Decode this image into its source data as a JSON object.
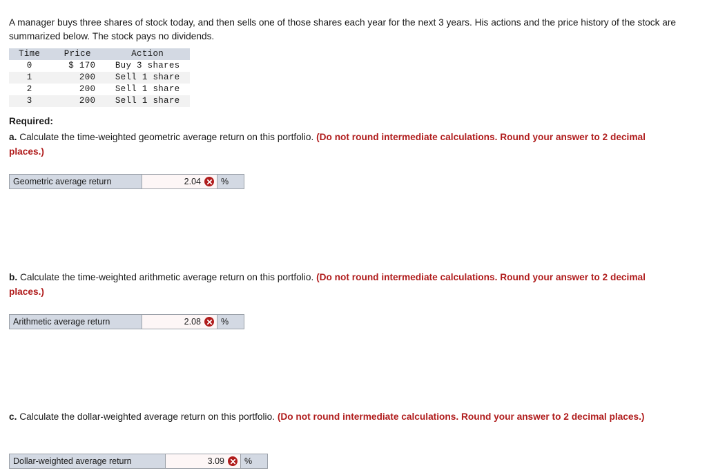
{
  "intro": {
    "paragraph": "A manager buys three shares of stock today, and then sells one of those shares each year for the next 3 years. His actions and the price history of the stock are summarized below. The stock pays no dividends."
  },
  "table": {
    "headers": [
      "Time",
      "Price",
      "Action"
    ],
    "rows": [
      {
        "time": "0",
        "price": "$ 170",
        "action": "Buy 3 shares"
      },
      {
        "time": "1",
        "price": "200",
        "action": "Sell 1 share"
      },
      {
        "time": "2",
        "price": "200",
        "action": "Sell 1 share"
      },
      {
        "time": "3",
        "price": "200",
        "action": "Sell 1 share"
      }
    ]
  },
  "required": {
    "heading": "Required:"
  },
  "questions": [
    {
      "label": "a.",
      "text": " Calculate the time-weighted geometric average return on this portfolio. ",
      "note": "(Do not round intermediate calculations. Round your answer to 2 decimal places.)"
    },
    {
      "label": "b.",
      "text": " Calculate the time-weighted arithmetic average return on this portfolio. ",
      "note": "(Do not round intermediate calculations. Round your answer to 2 decimal places.)"
    },
    {
      "label": "c.",
      "text": " Calculate the dollar-weighted average return on this portfolio. ",
      "note": "(Do not round intermediate calculations. Round your answer to 2 decimal places.)"
    }
  ],
  "answers": [
    {
      "label": "Geometric average return",
      "value": "2.04",
      "status": "incorrect-icon",
      "unit": "%"
    },
    {
      "label": "Arithmetic average return",
      "value": "2.08",
      "status": "incorrect-icon",
      "unit": "%"
    },
    {
      "label": "Dollar-weighted average return",
      "value": "3.09",
      "status": "incorrect-icon",
      "unit": "%"
    }
  ],
  "colors": {
    "note_red": "#b01c1c",
    "header_bg": "#d3d9e3",
    "value_bg": "#fdf6f6",
    "stripe_bg": "#f2f2f2",
    "border": "#9aa0a8"
  }
}
